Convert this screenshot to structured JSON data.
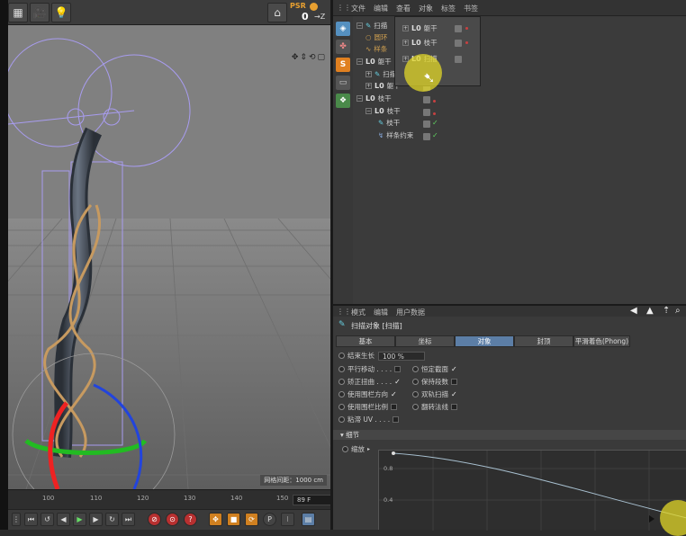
{
  "header": {
    "psr_label": "PSR",
    "psr_value": "0",
    "psr_axis": "→Z"
  },
  "viewport": {
    "grid_spacing": "网格间距：1000 cm"
  },
  "timeline": {
    "ticks": [
      "100",
      "110",
      "120",
      "130",
      "140",
      "150"
    ],
    "frame": "89 F"
  },
  "om": {
    "menus": [
      "文件",
      "编辑",
      "查看",
      "对象",
      "标签",
      "书签"
    ],
    "rows": [
      {
        "label": "扫描",
        "indent": 0
      },
      {
        "label": "圆环",
        "indent": 1
      },
      {
        "label": "样条",
        "indent": 1
      },
      {
        "label": "躯干",
        "indent": 0,
        "lo": "L0"
      },
      {
        "label": "扫描",
        "indent": 1
      },
      {
        "label": "躯干",
        "indent": 1,
        "lo": "L0"
      },
      {
        "label": "枝干",
        "indent": 0,
        "lo": "L0"
      },
      {
        "label": "枝干",
        "indent": 1,
        "lo": "L0"
      },
      {
        "label": "枝干",
        "indent": 2
      },
      {
        "label": "样条约束",
        "indent": 2
      }
    ],
    "popup_rows": [
      {
        "label": "躯干",
        "lo": "L0"
      },
      {
        "label": "枝干",
        "lo": "L0"
      },
      {
        "label": "扫描",
        "lo": "L0"
      }
    ]
  },
  "am": {
    "menus": [
      "模式",
      "编辑",
      "用户数据"
    ],
    "object_title": "扫描对象 [扫描]",
    "tabs": [
      "基本",
      "坐标",
      "对象",
      "封顶",
      "平滑着色(Phong)"
    ],
    "active_tab": 2,
    "growth_label": "结束生长",
    "growth_value": "100 %",
    "props_left": [
      {
        "label": "平行移动 . . . .",
        "checked": false
      },
      {
        "label": "矫正扭曲 . . . .",
        "checked": true
      },
      {
        "label": "使用围栏方向",
        "checked": true
      },
      {
        "label": "使用围栏比例",
        "checked": false
      },
      {
        "label": "粘滞 UV . . . .",
        "checked": false
      }
    ],
    "props_right": [
      {
        "label": "恒定截面",
        "checked": true
      },
      {
        "label": "保持段数",
        "checked": false
      },
      {
        "label": "双轨扫描",
        "checked": true
      },
      {
        "label": "翻转法线",
        "checked": false
      }
    ],
    "section": "细节",
    "scale_label": "缩放",
    "graph_ticks": [
      "0.8",
      "0.4"
    ]
  }
}
